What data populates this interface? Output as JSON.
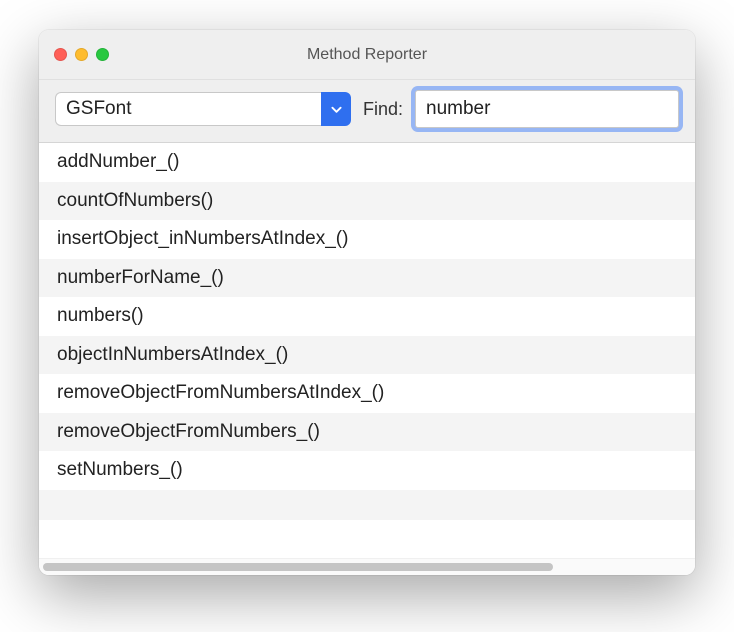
{
  "window": {
    "title": "Method Reporter"
  },
  "toolbar": {
    "class_value": "GSFont",
    "find_label": "Find:",
    "find_value": "number"
  },
  "results": [
    "addNumber_()",
    "countOfNumbers()",
    "insertObject_inNumbersAtIndex_()",
    "numberForName_()",
    "numbers()",
    "objectInNumbersAtIndex_()",
    "removeObjectFromNumbersAtIndex_()",
    "removeObjectFromNumbers_()",
    "setNumbers_()"
  ]
}
